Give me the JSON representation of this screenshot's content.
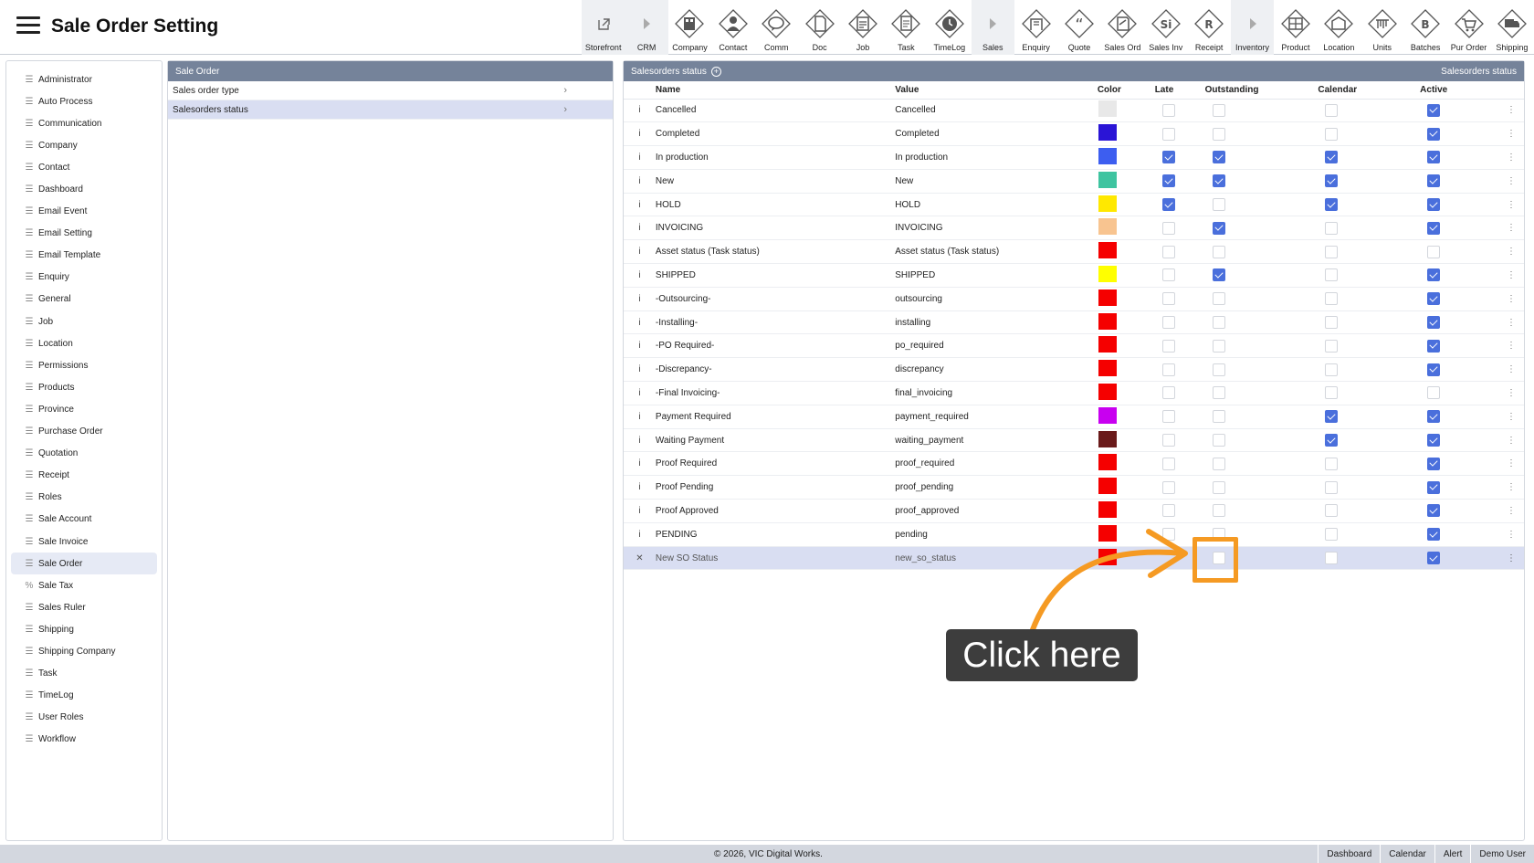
{
  "header": {
    "title": "Sale Order Setting",
    "nav": [
      {
        "label": "Storefront",
        "icon": "external-link-icon",
        "sep": true
      },
      {
        "label": "CRM",
        "icon": "caret-right-icon",
        "sep": true
      },
      {
        "label": "Company",
        "icon": "company-icon",
        "sep": false
      },
      {
        "label": "Contact",
        "icon": "contact-icon",
        "sep": false
      },
      {
        "label": "Comm",
        "icon": "comm-icon",
        "sep": false
      },
      {
        "label": "Doc",
        "icon": "doc-icon",
        "sep": false
      },
      {
        "label": "Job",
        "icon": "job-icon",
        "sep": false
      },
      {
        "label": "Task",
        "icon": "task-icon",
        "sep": false
      },
      {
        "label": "TimeLog",
        "icon": "timelog-icon",
        "sep": false
      },
      {
        "label": "Sales",
        "icon": "caret-right-icon",
        "sep": true
      },
      {
        "label": "Enquiry",
        "icon": "enquiry-icon",
        "sep": false
      },
      {
        "label": "Quote",
        "icon": "quote-icon",
        "sep": false
      },
      {
        "label": "Sales Ord",
        "icon": "sales-order-icon",
        "sep": false
      },
      {
        "label": "Sales Inv",
        "icon": "sales-invoice-icon",
        "glyph": "Si",
        "sep": false
      },
      {
        "label": "Receipt",
        "icon": "receipt-icon",
        "glyph": "R",
        "sep": false
      },
      {
        "label": "Inventory",
        "icon": "caret-right-icon",
        "sep": true
      },
      {
        "label": "Product",
        "icon": "product-icon",
        "sep": false
      },
      {
        "label": "Location",
        "icon": "location-icon",
        "sep": false
      },
      {
        "label": "Units",
        "icon": "units-icon",
        "sep": false
      },
      {
        "label": "Batches",
        "icon": "batches-icon",
        "glyph": "B",
        "sep": false
      },
      {
        "label": "Pur Order",
        "icon": "cart-icon",
        "sep": false
      },
      {
        "label": "Shipping",
        "icon": "truck-icon",
        "sep": false
      }
    ]
  },
  "sidebar": {
    "items": [
      {
        "label": "Administrator",
        "icon": "list-icon"
      },
      {
        "label": "Auto Process",
        "icon": "list-icon"
      },
      {
        "label": "Communication",
        "icon": "list-icon"
      },
      {
        "label": "Company",
        "icon": "list-icon"
      },
      {
        "label": "Contact",
        "icon": "list-icon"
      },
      {
        "label": "Dashboard",
        "icon": "list-icon"
      },
      {
        "label": "Email Event",
        "icon": "list-icon"
      },
      {
        "label": "Email Setting",
        "icon": "list-icon"
      },
      {
        "label": "Email Template",
        "icon": "list-icon"
      },
      {
        "label": "Enquiry",
        "icon": "list-icon"
      },
      {
        "label": "General",
        "icon": "list-icon"
      },
      {
        "label": "Job",
        "icon": "list-icon"
      },
      {
        "label": "Location",
        "icon": "list-icon"
      },
      {
        "label": "Permissions",
        "icon": "list-icon"
      },
      {
        "label": "Products",
        "icon": "list-icon"
      },
      {
        "label": "Province",
        "icon": "list-icon"
      },
      {
        "label": "Purchase Order",
        "icon": "list-icon"
      },
      {
        "label": "Quotation",
        "icon": "list-icon"
      },
      {
        "label": "Receipt",
        "icon": "list-icon"
      },
      {
        "label": "Roles",
        "icon": "list-icon"
      },
      {
        "label": "Sale Account",
        "icon": "list-icon"
      },
      {
        "label": "Sale Invoice",
        "icon": "list-icon"
      },
      {
        "label": "Sale Order",
        "icon": "list-icon",
        "active": true
      },
      {
        "label": "Sale Tax",
        "icon": "percent-icon"
      },
      {
        "label": "Sales Ruler",
        "icon": "list-icon"
      },
      {
        "label": "Shipping",
        "icon": "list-icon"
      },
      {
        "label": "Shipping Company",
        "icon": "list-icon"
      },
      {
        "label": "Task",
        "icon": "list-icon"
      },
      {
        "label": "TimeLog",
        "icon": "list-icon"
      },
      {
        "label": "User Roles",
        "icon": "list-icon"
      },
      {
        "label": "Workflow",
        "icon": "list-icon"
      }
    ]
  },
  "middle_panel": {
    "title": "Sale Order",
    "items": [
      {
        "label": "Sales order type",
        "active": false
      },
      {
        "label": "Salesorders status",
        "active": true
      }
    ]
  },
  "right_panel": {
    "title": "Salesorders status",
    "title_right": "Salesorders status",
    "columns": [
      "Name",
      "Value",
      "Color",
      "Late",
      "Outstanding",
      "Calendar",
      "Active"
    ],
    "rows": [
      {
        "name": "Cancelled",
        "value": "Cancelled",
        "color": "#e8e8e8",
        "late": false,
        "outstanding": false,
        "calendar": false,
        "active": true
      },
      {
        "name": "Completed",
        "value": "Completed",
        "color": "#2a14d6",
        "late": false,
        "outstanding": false,
        "calendar": false,
        "active": true
      },
      {
        "name": "In production",
        "value": "In production",
        "color": "#3d5ef0",
        "late": true,
        "outstanding": true,
        "calendar": true,
        "active": true
      },
      {
        "name": "New",
        "value": "New",
        "color": "#3ec4a0",
        "late": true,
        "outstanding": true,
        "calendar": true,
        "active": true
      },
      {
        "name": "HOLD",
        "value": "HOLD",
        "color": "#ffe800",
        "late": true,
        "outstanding": false,
        "calendar": true,
        "active": true
      },
      {
        "name": "INVOICING",
        "value": "INVOICING",
        "color": "#f8c490",
        "late": false,
        "outstanding": true,
        "calendar": false,
        "active": true
      },
      {
        "name": "Asset status (Task status)",
        "value": "Asset status (Task status)",
        "color": "#f50000",
        "late": false,
        "outstanding": false,
        "calendar": false,
        "active": false
      },
      {
        "name": "SHIPPED",
        "value": "SHIPPED",
        "color": "#ffff00",
        "late": false,
        "outstanding": true,
        "calendar": false,
        "active": true
      },
      {
        "name": "-Outsourcing-",
        "value": "outsourcing",
        "color": "#f50000",
        "late": false,
        "outstanding": false,
        "calendar": false,
        "active": true
      },
      {
        "name": "-Installing-",
        "value": "installing",
        "color": "#f50000",
        "late": false,
        "outstanding": false,
        "calendar": false,
        "active": true
      },
      {
        "name": "-PO Required-",
        "value": "po_required",
        "color": "#f50000",
        "late": false,
        "outstanding": false,
        "calendar": false,
        "active": true
      },
      {
        "name": "-Discrepancy-",
        "value": "discrepancy",
        "color": "#f50000",
        "late": false,
        "outstanding": false,
        "calendar": false,
        "active": true
      },
      {
        "name": "-Final Invoicing-",
        "value": "final_invoicing",
        "color": "#f50000",
        "late": false,
        "outstanding": false,
        "calendar": false,
        "active": false
      },
      {
        "name": "Payment Required",
        "value": "payment_required",
        "color": "#c800f0",
        "late": false,
        "outstanding": false,
        "calendar": true,
        "active": true
      },
      {
        "name": "Waiting Payment",
        "value": "waiting_payment",
        "color": "#6a1a1a",
        "late": false,
        "outstanding": false,
        "calendar": true,
        "active": true
      },
      {
        "name": "Proof Required",
        "value": "proof_required",
        "color": "#f50000",
        "late": false,
        "outstanding": false,
        "calendar": false,
        "active": true
      },
      {
        "name": "Proof Pending",
        "value": "proof_pending",
        "color": "#f50000",
        "late": false,
        "outstanding": false,
        "calendar": false,
        "active": true
      },
      {
        "name": "Proof Approved",
        "value": "proof_approved",
        "color": "#f50000",
        "late": false,
        "outstanding": false,
        "calendar": false,
        "active": true
      },
      {
        "name": "PENDING",
        "value": "pending",
        "color": "#f50000",
        "late": false,
        "outstanding": false,
        "calendar": false,
        "active": true
      },
      {
        "name": "New SO Status",
        "value": "new_so_status",
        "color": "#f50000",
        "late": null,
        "outstanding": false,
        "calendar": false,
        "active": true,
        "is_new": true
      }
    ]
  },
  "footer": {
    "copyright": "© 2026, VIC Digital Works.",
    "links": [
      "Dashboard",
      "Calendar",
      "Alert",
      "Demo User"
    ]
  },
  "annotation": {
    "callout_text": "Click here",
    "accent": "#f59a23"
  }
}
